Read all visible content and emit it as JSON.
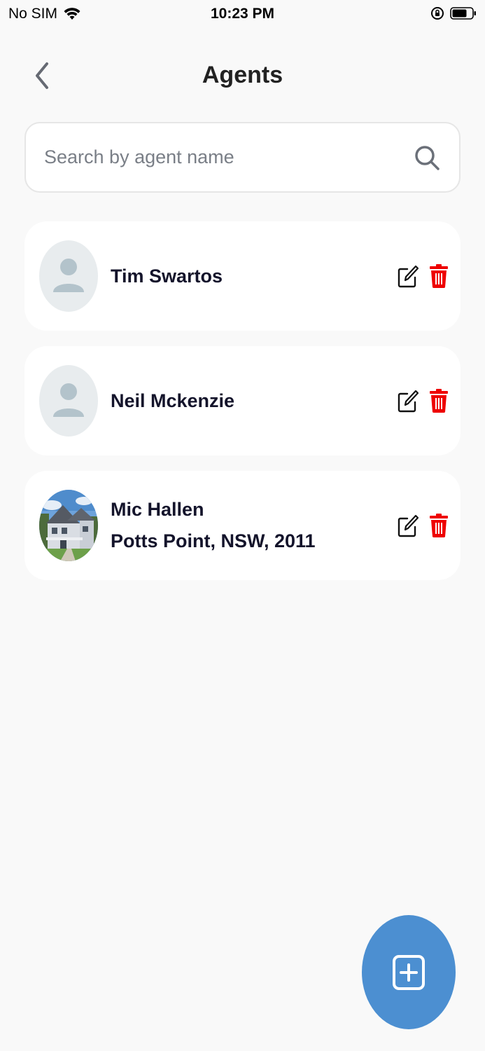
{
  "status_bar": {
    "carrier": "No SIM",
    "time": "10:23 PM"
  },
  "header": {
    "title": "Agents",
    "back_icon": "chevron-left-icon"
  },
  "search": {
    "placeholder": "Search by agent name",
    "value": "",
    "icon": "search-icon"
  },
  "agents": [
    {
      "name": "Tim Swartos",
      "location": "",
      "avatar": "person-placeholder"
    },
    {
      "name": "Neil Mckenzie",
      "location": "",
      "avatar": "person-placeholder"
    },
    {
      "name": "Mic Hallen",
      "location": "Potts Point, NSW, 2011",
      "avatar": "house-photo"
    }
  ],
  "actions": {
    "edit_icon": "edit-icon",
    "delete_icon": "trash-icon"
  },
  "fab": {
    "icon": "add-square-icon"
  },
  "colors": {
    "background": "#f9f9f9",
    "card": "#ffffff",
    "text": "#14142b",
    "delete": "#ee0000",
    "fab": "#4c8fd1",
    "avatar_bg": "#e8ecee",
    "avatar_fg": "#b3c3cb"
  }
}
